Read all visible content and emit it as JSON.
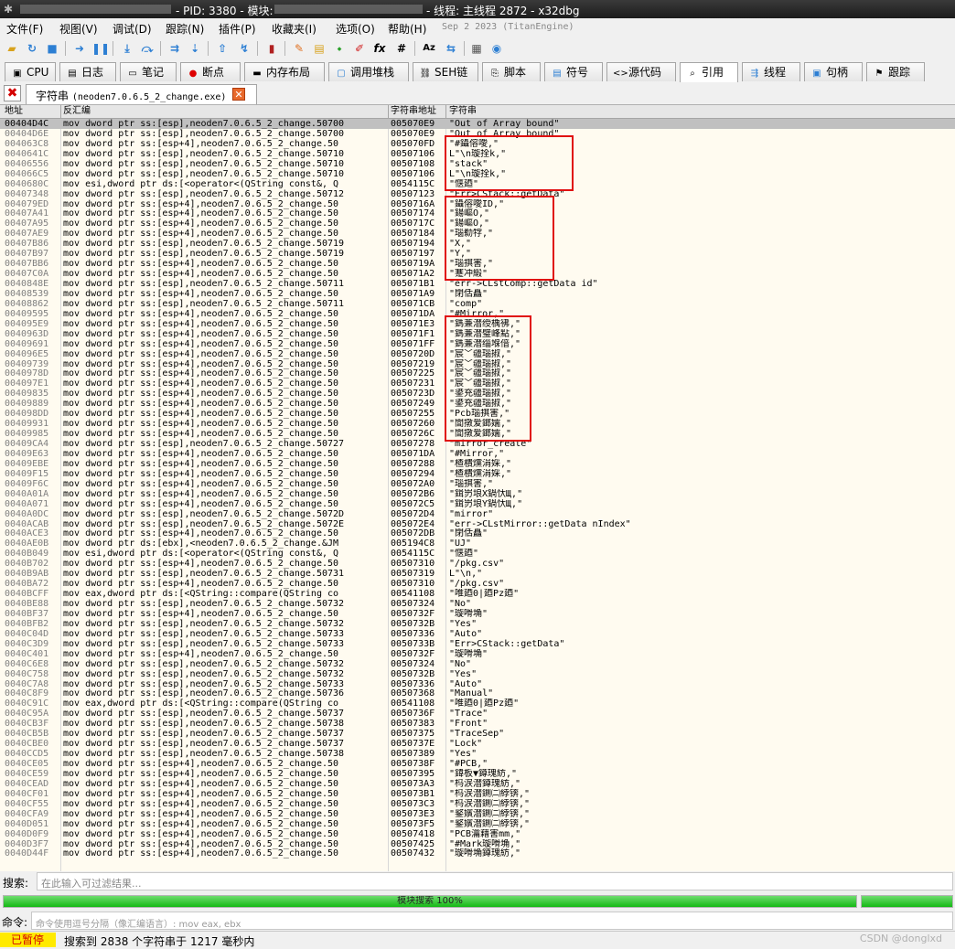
{
  "titlebar": {
    "title_mid": "- PID: 3380 - 模块:",
    "title_right": "- 线程: 主线程 2872 - x32dbg"
  },
  "menu": [
    "文件(F)",
    "视图(V)",
    "调试(D)",
    "跟踪(N)",
    "插件(P)",
    "收藏夹(I)",
    "选项(O)",
    "帮助(H)"
  ],
  "menu_date": "Sep 2 2023 (TitanEngine)",
  "toolbar_icons": [
    "open-icon",
    "restart-icon",
    "stop-icon",
    "run-icon",
    "pause-icon",
    "step-into-icon",
    "step-over-icon",
    "trace-into-icon",
    "trace-over-icon",
    "execute-till-return-icon",
    "run-to-user-code-icon",
    "scylla-icon",
    "patch-icon",
    "comment-icon",
    "label-icon",
    "bookmark-icon",
    "function-icon",
    "hash-icon",
    "font-icon",
    "calculator-icon",
    "help-icon"
  ],
  "tabs": [
    {
      "label": "CPU",
      "icon": "cpu-icon"
    },
    {
      "label": "日志",
      "icon": "log-icon"
    },
    {
      "label": "笔记",
      "icon": "notes-icon"
    },
    {
      "label": "断点",
      "icon": "breakpoint-icon"
    },
    {
      "label": "内存布局",
      "icon": "memory-map-icon"
    },
    {
      "label": "调用堆栈",
      "icon": "call-stack-icon"
    },
    {
      "label": "SEH链",
      "icon": "seh-chain-icon"
    },
    {
      "label": "脚本",
      "icon": "script-icon"
    },
    {
      "label": "符号",
      "icon": "symbols-icon"
    },
    {
      "label": "源代码",
      "icon": "source-icon"
    },
    {
      "label": "引用",
      "icon": "references-icon",
      "active": true
    },
    {
      "label": "线程",
      "icon": "threads-icon"
    },
    {
      "label": "句柄",
      "icon": "handles-icon"
    },
    {
      "label": "跟踪",
      "icon": "trace-icon"
    }
  ],
  "subtab": {
    "label_prefix": "字符串",
    "label_module": "(neoden7.0.6.5_2_change.exe)"
  },
  "columns": [
    "地址",
    "反汇编",
    "字符串地址",
    "字符串"
  ],
  "rows": [
    [
      "00404D4C",
      "mov dword ptr ss:[esp],neoden7.0.6.5_2_change.50700",
      "005070E9",
      "\"Out of Array bound\""
    ],
    [
      "00404D6E",
      "mov dword ptr ss:[esp],neoden7.0.6.5_2_change.50700",
      "005070E9",
      "\"Out of Array bound\""
    ],
    [
      "004063C8",
      "mov dword ptr ss:[esp+4],neoden7.0.6.5_2_change.50",
      "005070FD",
      "\"#鑷傛噯,\""
    ],
    [
      "0040641C",
      "mov dword ptr ss:[esp],neoden7.0.6.5_2_change.50710",
      "00507106",
      "L\"\\n璇拴k,\""
    ],
    [
      "00406556",
      "mov dword ptr ss:[esp],neoden7.0.6.5_2_change.50710",
      "00507108",
      "\"stack\""
    ],
    [
      "004066C5",
      "mov dword ptr ss:[esp],neoden7.0.6.5_2_change.50710",
      "00507106",
      "L\"\\n璇拴k,\""
    ],
    [
      "0040680C",
      "mov esi,dword ptr ds:[<operator<(QString const&, Q",
      "0054115C",
      "\"惬廼\""
    ],
    [
      "00407348",
      "mov dword ptr ss:[esp],neoden7.0.6.5_2_change.50712",
      "00507123",
      "\"Err>CStack::getData\""
    ],
    [
      "004079ED",
      "mov dword ptr ss:[esp+4],neoden7.0.6.5_2_change.50",
      "0050716A",
      "\"鑷傛噯ID,\""
    ],
    [
      "00407A41",
      "mov dword ptr ss:[esp+4],neoden7.0.6.5_2_change.50",
      "00507174",
      "\"鍚嶇О,\""
    ],
    [
      "00407A95",
      "mov dword ptr ss:[esp+4],neoden7.0.6.5_2_change.50",
      "0050717C",
      "\"鍚嶇О,\""
    ],
    [
      "00407AE9",
      "mov dword ptr ss:[esp+4],neoden7.0.6.5_2_change.50",
      "00507184",
      "\"瑙勬牸,\""
    ],
    [
      "00407B86",
      "mov dword ptr ss:[esp],neoden7.0.6.5_2_change.50719",
      "00507194",
      "\"X,\""
    ],
    [
      "00407B97",
      "mov dword ptr ss:[esp],neoden7.0.6.5_2_change.50719",
      "00507197",
      "\"Y,\""
    ],
    [
      "00407BB6",
      "mov dword ptr ss:[esp+4],neoden7.0.6.5_2_change.50",
      "0050719A",
      "\"瑙掑害,\""
    ],
    [
      "00407C0A",
      "mov dword ptr ss:[esp+4],neoden7.0.6.5_2_change.50",
      "005071A2",
      "\"蹇冲緞\""
    ],
    [
      "0040848E",
      "mov dword ptr ss:[esp],neoden7.0.6.5_2_change.50711",
      "005071B1",
      "\"err->CLstComp::getData id\""
    ],
    [
      "00408539",
      "mov dword ptr ss:[esp+4],neoden7.0.6.5_2_change.50",
      "005071A9",
      "\"閉佸矗\""
    ],
    [
      "00408862",
      "mov dword ptr ss:[esp],neoden7.0.6.5_2_change.50711",
      "005071CB",
      "\"comp\""
    ],
    [
      "00409595",
      "mov dword ptr ss:[esp+4],neoden7.0.6.5_2_change.50",
      "005071DA",
      "\"#Mirror,\""
    ],
    [
      "004095E9",
      "mov dword ptr ss:[esp+4],neoden7.0.6.5_2_change.50",
      "005071E3",
      "\"鎷兼澘绶楀彿,\""
    ],
    [
      "0040963D",
      "mov dword ptr ss:[esp+4],neoden7.0.6.5_2_change.50",
      "005071F1",
      "\"鎷兼澘璧峰點,\""
    ],
    [
      "00409691",
      "mov dword ptr ss:[esp+4],neoden7.0.6.5_2_change.50",
      "005071FF",
      "\"鎷兼澘缁堢偣,\""
    ],
    [
      "004096E5",
      "mov dword ptr ss:[esp+4],neoden7.0.6.5_2_change.50",
      "0050720D",
      "\"宸﹀疆瑙掓,\""
    ],
    [
      "00409739",
      "mov dword ptr ss:[esp+4],neoden7.0.6.5_2_change.50",
      "00507219",
      "\"宸﹀疆瑙掓,\""
    ],
    [
      "0040978D",
      "mov dword ptr ss:[esp+4],neoden7.0.6.5_2_change.50",
      "00507225",
      "\"宸﹀疆瑙掓,\""
    ],
    [
      "004097E1",
      "mov dword ptr ss:[esp+4],neoden7.0.6.5_2_change.50",
      "00507231",
      "\"宸﹀疆瑙掓,\""
    ],
    [
      "00409835",
      "mov dword ptr ss:[esp+4],neoden7.0.6.5_2_change.50",
      "0050723D",
      "\"鍙充疆瑙掓,\""
    ],
    [
      "00409889",
      "mov dword ptr ss:[esp+4],neoden7.0.6.5_2_change.50",
      "00507249",
      "\"鍙充疆瑙掓,\""
    ],
    [
      "004098DD",
      "mov dword ptr ss:[esp+4],neoden7.0.6.5_2_change.50",
      "00507255",
      "\"Pcb瑙掑害,\""
    ],
    [
      "00409931",
      "mov dword ptr ss:[esp+4],neoden7.0.6.5_2_change.50",
      "00507260",
      "\"閭撴爱鎯嬬,\""
    ],
    [
      "00409985",
      "mov dword ptr ss:[esp+4],neoden7.0.6.5_2_change.50",
      "0050726C",
      "\"閭撴爱鎯嬬,\""
    ],
    [
      "00409CA4",
      "mov dword ptr ss:[esp],neoden7.0.6.5_2_change.50727",
      "00507278",
      "\"mirror_create\""
    ],
    [
      "00409E63",
      "mov dword ptr ss:[esp+4],neoden7.0.6.5_2_change.50",
      "005071DA",
      "\"#Mirror,\""
    ],
    [
      "00409EBE",
      "mov dword ptr ss:[esp+4],neoden7.0.6.5_2_change.50",
      "00507288",
      "\"楂樻爣涓婇,\""
    ],
    [
      "00409F15",
      "mov dword ptr ss:[esp+4],neoden7.0.6.5_2_change.50",
      "00507294",
      "\"楂樻爣涓婇,\""
    ],
    [
      "00409F6C",
      "mov dword ptr ss:[esp+4],neoden7.0.6.5_2_change.50",
      "005072A0",
      "\"瑙掑害,\""
    ],
    [
      "0040A01A",
      "mov dword ptr ss:[esp+4],neoden7.0.6.5_2_change.50",
      "005072B6",
      "\"鍓岃埌X鍋忕Щ,\""
    ],
    [
      "0040A071",
      "mov dword ptr ss:[esp+4],neoden7.0.6.5_2_change.50",
      "005072C5",
      "\"鍓岃埌Y鍋忕Щ,\""
    ],
    [
      "0040A0DC",
      "mov dword ptr ss:[esp],neoden7.0.6.5_2_change.5072D",
      "005072D4",
      "\"mirror\""
    ],
    [
      "0040ACAB",
      "mov dword ptr ss:[esp],neoden7.0.6.5_2_change.5072E",
      "005072E4",
      "\"err->CLstMirror::getData nIndex\""
    ],
    [
      "0040ACE3",
      "mov dword ptr ss:[esp+4],neoden7.0.6.5_2_change.50",
      "005072DB",
      "\"閉佸矗\""
    ],
    [
      "0040AE0B",
      "mov dword ptr ds:[ebx],<neoden7.0.6.5_2_change.&JM",
      "005194C8",
      "\"UJ\""
    ],
    [
      "0040B049",
      "mov esi,dword ptr ds:[<operator<(QString const&, Q",
      "0054115C",
      "\"惬廼\""
    ],
    [
      "0040B702",
      "mov dword ptr ss:[esp+4],neoden7.0.6.5_2_change.50",
      "00507310",
      "\"/pkg.csv\""
    ],
    [
      "0040B9AB",
      "mov dword ptr ss:[esp],neoden7.0.6.5_2_change.50731",
      "00507319",
      "L\"\\n,\""
    ],
    [
      "0040BA72",
      "mov dword ptr ss:[esp+4],neoden7.0.6.5_2_change.50",
      "00507310",
      "\"/pkg.csv\""
    ],
    [
      "0040BCFF",
      "mov eax,dword ptr ds:[<QString::compare(QString co",
      "00541108",
      "\"唯廼0|廼Pz廼\""
    ],
    [
      "0040BE88",
      "mov dword ptr ss:[esp],neoden7.0.6.5_2_change.50732",
      "00507324",
      "\"No\""
    ],
    [
      "0040BF37",
      "mov dword ptr ss:[esp+4],neoden7.0.6.5_2_change.50",
      "0050732F",
      "\"璇嗗埆\""
    ],
    [
      "0040BFB2",
      "mov dword ptr ss:[esp],neoden7.0.6.5_2_change.50732",
      "0050732B",
      "\"Yes\""
    ],
    [
      "0040C04D",
      "mov dword ptr ss:[esp],neoden7.0.6.5_2_change.50733",
      "00507336",
      "\"Auto\""
    ],
    [
      "0040C3D9",
      "mov dword ptr ss:[esp],neoden7.0.6.5_2_change.50733",
      "0050733B",
      "\"Err>CStack::getData\""
    ],
    [
      "0040C401",
      "mov dword ptr ss:[esp+4],neoden7.0.6.5_2_change.50",
      "0050732F",
      "\"璇嗗埆\""
    ],
    [
      "0040C6E8",
      "mov dword ptr ss:[esp],neoden7.0.6.5_2_change.50732",
      "00507324",
      "\"No\""
    ],
    [
      "0040C758",
      "mov dword ptr ss:[esp],neoden7.0.6.5_2_change.50732",
      "0050732B",
      "\"Yes\""
    ],
    [
      "0040C7A8",
      "mov dword ptr ss:[esp],neoden7.0.6.5_2_change.50733",
      "00507336",
      "\"Auto\""
    ],
    [
      "0040C8F9",
      "mov dword ptr ss:[esp],neoden7.0.6.5_2_change.50736",
      "00507368",
      "\"Manual\""
    ],
    [
      "0040C91C",
      "mov eax,dword ptr ds:[<QString::compare(QString co",
      "00541108",
      "\"唯廼0|廼Pz廼\""
    ],
    [
      "0040C95A",
      "mov dword ptr ss:[esp],neoden7.0.6.5_2_change.50737",
      "0050736F",
      "\"Trace\""
    ],
    [
      "0040CB3F",
      "mov dword ptr ss:[esp],neoden7.0.6.5_2_change.50738",
      "00507383",
      "\"Front\""
    ],
    [
      "0040CB5B",
      "mov dword ptr ss:[esp],neoden7.0.6.5_2_change.50737",
      "00507375",
      "\"TraceSep\""
    ],
    [
      "0040CBE0",
      "mov dword ptr ss:[esp],neoden7.0.6.5_2_change.50737",
      "0050737E",
      "\"Lock\""
    ],
    [
      "0040CCD5",
      "mov dword ptr ss:[esp],neoden7.0.6.5_2_change.50738",
      "00507389",
      "\"Yes\""
    ],
    [
      "0040CE05",
      "mov dword ptr ss:[esp+4],neoden7.0.6.5_2_change.50",
      "0050738F",
      "\"#PCB,\""
    ],
    [
      "0040CE59",
      "mov dword ptr ss:[esp+4],neoden7.0.6.5_2_change.50",
      "00507395",
      "\"鍏板▼鐏瑰紡,\""
    ],
    [
      "0040CEAD",
      "mov dword ptr ss:[esp+4],neoden7.0.6.5_2_change.50",
      "005073A3",
      "\"杩涙澘鐏瑰紡,\""
    ],
    [
      "0040CF01",
      "mov dword ptr ss:[esp+4],neoden7.0.6.5_2_change.50",
      "005073B1",
      "\"杩涙澘鍘㈡綍锛,\""
    ],
    [
      "0040CF55",
      "mov dword ptr ss:[esp+4],neoden7.0.6.5_2_change.50",
      "005073C3",
      "\"杩涙澘鍘㈡綍锛,\""
    ],
    [
      "0040CFA9",
      "mov dword ptr ss:[esp+4],neoden7.0.6.5_2_change.50",
      "005073E3",
      "\"鐜嬪澘鍘㈡綍锛,\""
    ],
    [
      "0040D051",
      "mov dword ptr ss:[esp+4],neoden7.0.6.5_2_change.50",
      "005073F5",
      "\"鐜嬪澘鍘㈡綍锛,\""
    ],
    [
      "0040D0F9",
      "mov dword ptr ss:[esp+4],neoden7.0.6.5_2_change.50",
      "00507418",
      "\"PCB瀹藉害mm,\""
    ],
    [
      "0040D3F7",
      "mov dword ptr ss:[esp+4],neoden7.0.6.5_2_change.50",
      "00507425",
      "\"#Mark璇嗗埆,\""
    ],
    [
      "0040D44F",
      "mov dword ptr ss:[esp+4],neoden7.0.6.5_2_change.50",
      "00507432",
      "\"璇嗗埆鐏瑰紡,\""
    ]
  ],
  "search": {
    "label": "搜索:",
    "placeholder": "在此输入可过滤结果..."
  },
  "progress": {
    "label": "模块搜索 100%",
    "value": 1.0
  },
  "command": {
    "label": "命令:",
    "placeholder": "命令使用逗号分隔（像汇编语言）: mov eax, ebx"
  },
  "status": {
    "state": "已暂停",
    "message": "搜索到  2838  个字符串于  1217  毫秒内",
    "watermark": "CSDN @donglxd"
  }
}
